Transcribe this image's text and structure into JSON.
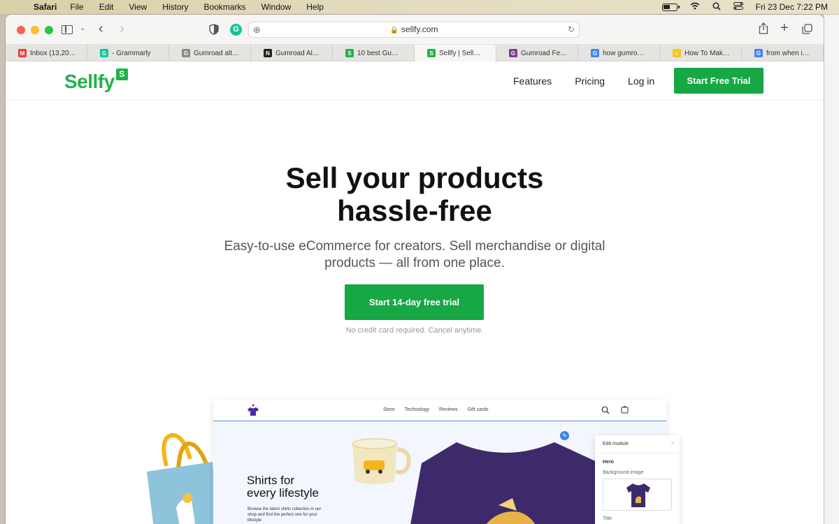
{
  "menubar": {
    "app_name": "Safari",
    "items": [
      "File",
      "Edit",
      "View",
      "History",
      "Bookmarks",
      "Window",
      "Help"
    ],
    "datetime": "Fri 23 Dec  7:22 PM"
  },
  "browser": {
    "url": "sellfy.com",
    "tabs": [
      {
        "label": "Inbox (13,20…",
        "favicon": "gmail-icon",
        "color": "#ea4335",
        "glyph": "M"
      },
      {
        "label": "- Grammarly",
        "favicon": "grammarly-icon",
        "color": "#15c39a",
        "glyph": "G"
      },
      {
        "label": "Gumroad alt…",
        "favicon": "gumroad-g-icon",
        "color": "#8a8a8a",
        "glyph": "G"
      },
      {
        "label": "Gumroad Al…",
        "favicon": "notion-icon",
        "color": "#222222",
        "glyph": "N"
      },
      {
        "label": "10 best Gu…",
        "favicon": "sellfy-icon",
        "color": "#21b24b",
        "glyph": "S"
      },
      {
        "label": "Sellfy | Sell…",
        "favicon": "sellfy-icon",
        "color": "#21b24b",
        "glyph": "S",
        "active": true
      },
      {
        "label": "Gumroad Fe…",
        "favicon": "gumroad-icon",
        "color": "#7b3f8c",
        "glyph": "G"
      },
      {
        "label": "how gumro…",
        "favicon": "google-icon",
        "color": "#4285f4",
        "glyph": "G"
      },
      {
        "label": "How To Mak…",
        "favicon": "smiley-icon",
        "color": "#f5c518",
        "glyph": "☺"
      },
      {
        "label": "from when i…",
        "favicon": "google-icon",
        "color": "#4285f4",
        "glyph": "G"
      }
    ]
  },
  "site": {
    "logo_text": "Sellfy",
    "logo_badge": "S",
    "brand_color": "#21b24b",
    "nav": [
      "Features",
      "Pricing",
      "Log in"
    ],
    "header_cta": "Start Free Trial",
    "hero": {
      "title_line1": "Sell your products",
      "title_line2": "hassle-free",
      "subtitle_line1": "Easy-to-use eCommerce for creators. Sell merchandise or digital",
      "subtitle_line2": "products — all from one place.",
      "cta": "Start 14-day free trial",
      "note": "No credit card required. Cancel anytime."
    },
    "mockup": {
      "nav": [
        "Store",
        "Technology",
        "Reviews",
        "Gift cards"
      ],
      "title_line1": "Shirts for",
      "title_line2": "every lifestyle",
      "body": "Browse the latest shirts collection in our shop and find the perfect one for your lifestyle",
      "panel": {
        "header": "Edit module",
        "section": "Hero",
        "label": "Background image",
        "next_label": "Title"
      }
    }
  }
}
